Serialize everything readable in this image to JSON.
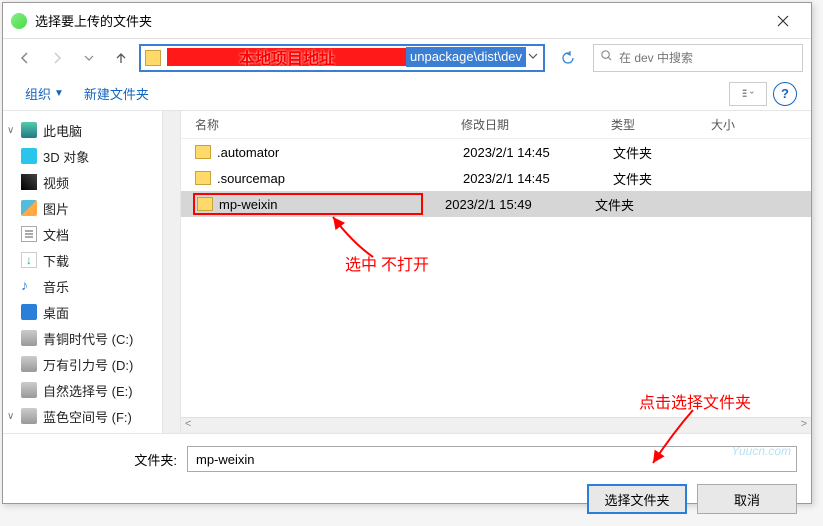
{
  "window": {
    "title": "选择要上传的文件夹"
  },
  "nav": {
    "address_path_visible": "unpackage\\dist\\dev",
    "address_annotation": "本地项目地址",
    "search_placeholder": "在 dev 中搜索"
  },
  "toolbar": {
    "organize": "组织",
    "new_folder": "新建文件夹",
    "help_symbol": "?"
  },
  "sidebar": {
    "items": [
      {
        "label": "此电脑",
        "icon": "pc",
        "exp": "∨"
      },
      {
        "label": "3D 对象",
        "icon": "3d"
      },
      {
        "label": "视频",
        "icon": "vid"
      },
      {
        "label": "图片",
        "icon": "pic"
      },
      {
        "label": "文档",
        "icon": "doc"
      },
      {
        "label": "下载",
        "icon": "dl"
      },
      {
        "label": "音乐",
        "icon": "music"
      },
      {
        "label": "桌面",
        "icon": "desk"
      },
      {
        "label": "青铜时代号 (C:)",
        "icon": "drive"
      },
      {
        "label": "万有引力号 (D:)",
        "icon": "drive"
      },
      {
        "label": "自然选择号 (E:)",
        "icon": "drive"
      },
      {
        "label": "蓝色空间号 (F:)",
        "icon": "drive",
        "exp": "∨"
      }
    ]
  },
  "headers": {
    "name": "名称",
    "date": "修改日期",
    "type": "类型",
    "size": "大小"
  },
  "files": [
    {
      "name": ".automator",
      "date": "2023/2/1 14:45",
      "type": "文件夹",
      "selected": false
    },
    {
      "name": ".sourcemap",
      "date": "2023/2/1 14:45",
      "type": "文件夹",
      "selected": false
    },
    {
      "name": "mp-weixin",
      "date": "2023/2/1 15:49",
      "type": "文件夹",
      "selected": true
    }
  ],
  "footer": {
    "folder_label": "文件夹:",
    "folder_value": "mp-weixin",
    "select_btn": "选择文件夹",
    "cancel_btn": "取消"
  },
  "annotations": {
    "select_not_open": "选中 不打开",
    "click_select_folder": "点击选择文件夹",
    "watermark": "Yuucn.com"
  }
}
